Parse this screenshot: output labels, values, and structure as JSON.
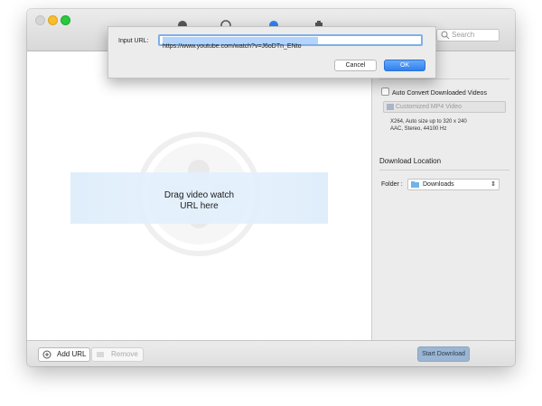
{
  "toolbar": {
    "search_placeholder": "Search"
  },
  "main": {
    "drop_text": "Drag video watch\nURL here"
  },
  "settings": {
    "auto_convert_label": "Auto Convert Downloaded Videos",
    "preset_label": "Customized MP4 Video",
    "preset_info_line1": "X264, Auto size up to 320 x 240",
    "preset_info_line2": "AAC, Stereo, 44100 Hz",
    "download_location_title": "Download Location",
    "folder_label": "Folder :",
    "folder_value": "Downloads"
  },
  "bottom": {
    "add_url_label": "Add URL",
    "remove_label": "Remove",
    "start_download_label": "Start Download"
  },
  "dialog": {
    "input_label": "Input URL:",
    "url_value": "https://www.youtube.com/watch?v=J6oDTn_ENto",
    "cancel_label": "Cancel",
    "ok_label": "OK"
  },
  "colors": {
    "accent_blue": "#2f80ef",
    "start_button": "#9ab6d2",
    "sidebar_bg": "#ececec"
  },
  "icons": [
    "close-icon",
    "minimize-icon",
    "maximize-icon",
    "download-icon",
    "convert-icon",
    "record-icon",
    "toolbox-icon",
    "search-icon",
    "preset-icon",
    "folder-icon",
    "add-icon",
    "remove-icon",
    "film-reel-icon"
  ]
}
